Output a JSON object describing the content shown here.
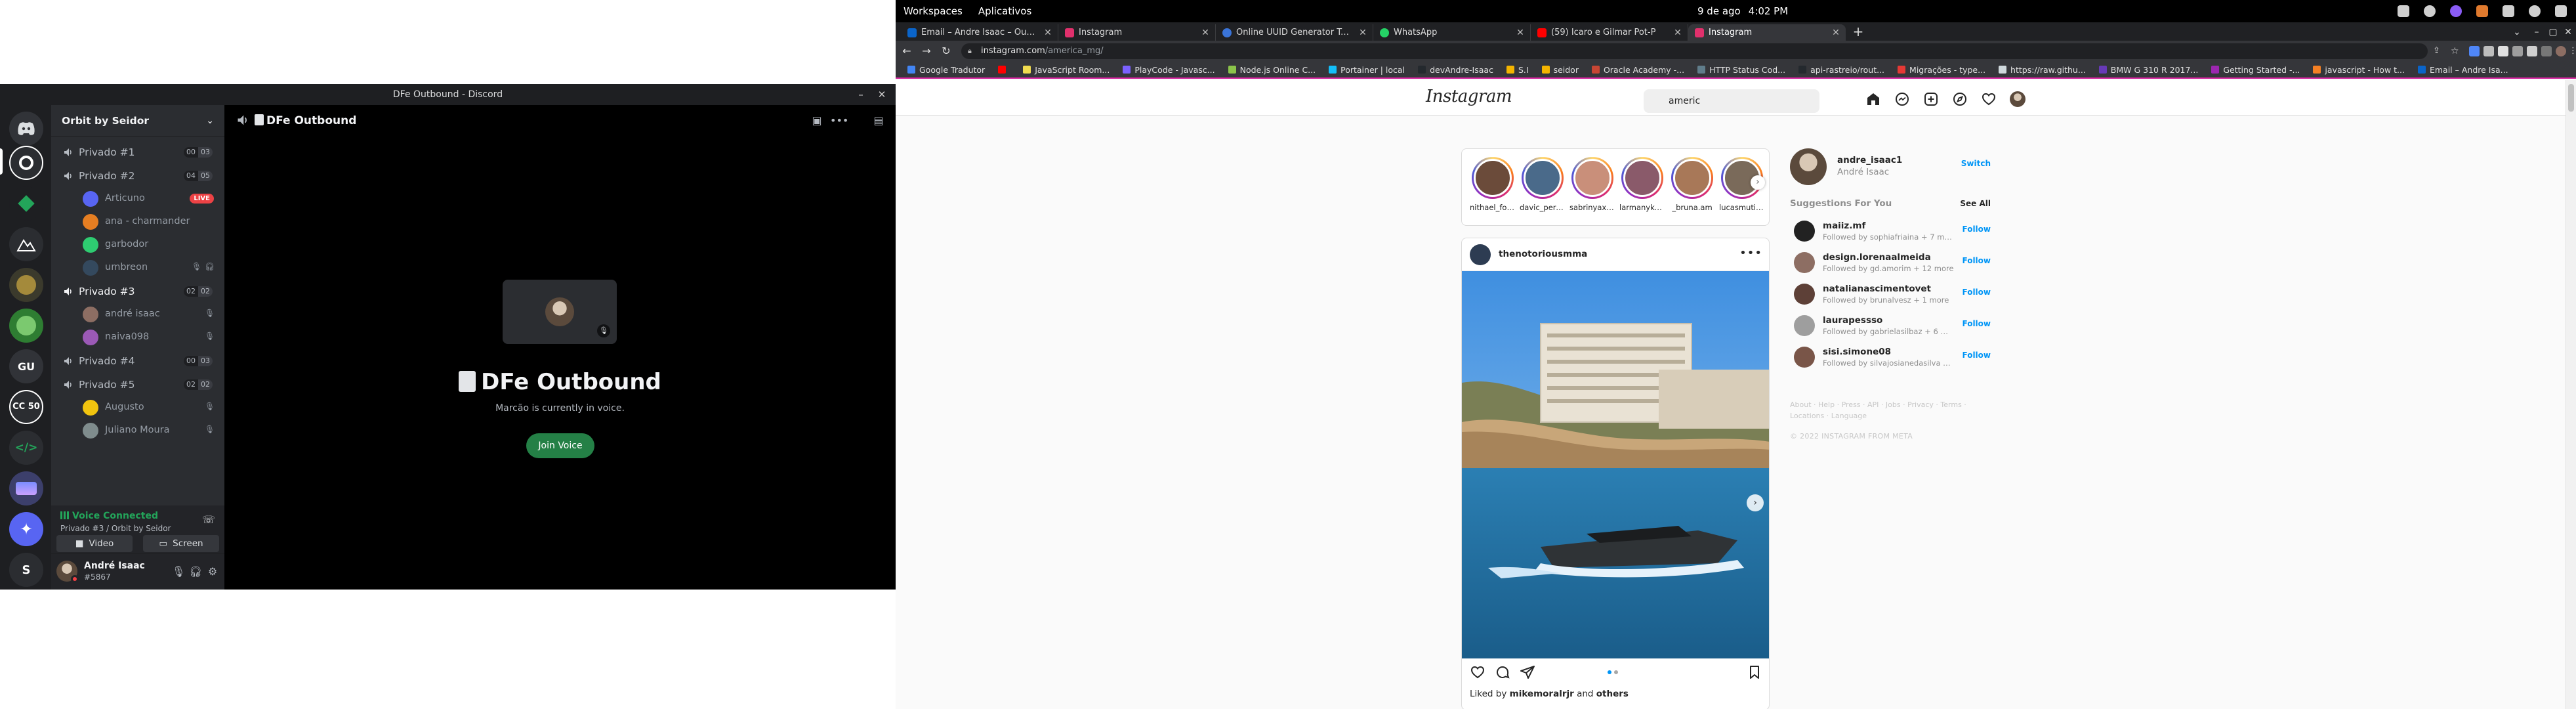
{
  "topbar": {
    "workspaces": "Workspaces",
    "apps": "Aplicativos",
    "date": "9 de ago",
    "time": "4:02 PM"
  },
  "browser": {
    "tabs": [
      {
        "title": "Email – Andre Isaac – Outlook",
        "fav": "#0a64c9"
      },
      {
        "title": "Instagram",
        "fav": "#e1306c"
      },
      {
        "title": "Online UUID Generator Tool",
        "fav": "#3a74d9"
      },
      {
        "title": "WhatsApp",
        "fav": "#25d366"
      },
      {
        "title": "(59) Icaro e Gilmar Pot-P",
        "fav": "#ff0000"
      },
      {
        "title": "Instagram",
        "fav": "#e1306c"
      }
    ],
    "url_host": "instagram.com",
    "url_path": "/america_mg/",
    "bookmarks": [
      {
        "label": "Google Tradutor",
        "fav": "#4285f4"
      },
      {
        "label": "",
        "fav": "#ff0000"
      },
      {
        "label": "JavaScript Room...",
        "fav": "#f0db4f"
      },
      {
        "label": "PlayCode - Javasc...",
        "fav": "#7b61ff"
      },
      {
        "label": "Node.js Online C...",
        "fav": "#8bc34a"
      },
      {
        "label": "Portainer | local",
        "fav": "#13bef9"
      },
      {
        "label": "devAndre-Isaac",
        "fav": "#24292e"
      },
      {
        "label": "S.I",
        "fav": "#f4b400"
      },
      {
        "label": "seidor",
        "fav": "#f4b400"
      },
      {
        "label": "Oracle Academy -...",
        "fav": "#c74634"
      },
      {
        "label": "HTTP Status Cod...",
        "fav": "#607d8b"
      },
      {
        "label": "api-rastreio/rout...",
        "fav": "#24292e"
      },
      {
        "label": "Migrações - type...",
        "fav": "#e53935"
      },
      {
        "label": "https://raw.githu...",
        "fav": "#cfd8dc"
      },
      {
        "label": "BMW G 310 R 2017...",
        "fav": "#673ab7"
      },
      {
        "label": "Getting Started -...",
        "fav": "#9c27b0"
      },
      {
        "label": "javascript - How t...",
        "fav": "#f48024"
      },
      {
        "label": "Email – Andre Isa...",
        "fav": "#0a64c9"
      }
    ]
  },
  "instagram": {
    "logo": "Instagram",
    "search_value": "americ",
    "stories": [
      {
        "name": "nithael_fon...",
        "color": "#6b4b3a"
      },
      {
        "name": "davic_perei...",
        "color": "#4a6a8a"
      },
      {
        "name": "sabrinyaxi...",
        "color": "#c98f7a"
      },
      {
        "name": "larmanykel...",
        "color": "#8a5a6a"
      },
      {
        "name": "_bruna.am",
        "color": "#a87858"
      },
      {
        "name": "lucasmutil...",
        "color": "#7a6a5a"
      }
    ],
    "post": {
      "user": "thenotoriousmma",
      "liked_by_prefix": "Liked by ",
      "liked_by_user": "mikemoralrjr",
      "liked_by_mid": " and ",
      "liked_by_others": "others"
    },
    "me": {
      "username": "andre_isaac1",
      "name": "André Isaac",
      "switch": "Switch"
    },
    "suggestions_title": "Suggestions For You",
    "see_all": "See All",
    "suggestions": [
      {
        "user": "maiiz.mf",
        "followed": "Followed by sophiafriaina + 7 more",
        "follow": "Follow",
        "color": "#222222"
      },
      {
        "user": "design.lorenaalmeida",
        "followed": "Followed by gd.amorim + 12 more",
        "follow": "Follow",
        "color": "#8d6e63"
      },
      {
        "user": "natalianascimentovet",
        "followed": "Followed by brunalvesz + 1 more",
        "follow": "Follow",
        "color": "#5d4037"
      },
      {
        "user": "laurapessso",
        "followed": "Followed by gabrielasilbaz + 6 more",
        "follow": "Follow",
        "color": "#9e9e9e"
      },
      {
        "user": "sisi.simone08",
        "followed": "Followed by silvajosianedasilva + 1...",
        "follow": "Follow",
        "color": "#795548"
      }
    ],
    "footer_line1": "About · Help · Press · API · Jobs · Privacy · Terms ·",
    "footer_line2": "Locations · Language",
    "copyright": "© 2022 INSTAGRAM FROM META"
  },
  "discord": {
    "window_title": "DFe Outbound - Discord",
    "guild": "Orbit by Seidor",
    "server_gu": "GU",
    "server_cc": "CC 50",
    "channels": [
      {
        "name": "Privado #1",
        "count_a": "00",
        "count_b": "03"
      },
      {
        "name": "Privado #2",
        "count_a": "04",
        "count_b": "05"
      },
      {
        "name": "Privado #3",
        "count_a": "02",
        "count_b": "02"
      },
      {
        "name": "Privado #4",
        "count_a": "00",
        "count_b": "03"
      },
      {
        "name": "Privado #5",
        "count_a": "02",
        "count_b": "02"
      }
    ],
    "users_p2": [
      {
        "name": "Articuno",
        "color": "#5865f2",
        "live": "LIVE"
      },
      {
        "name": "ana - charmander",
        "color": "#e67e22"
      },
      {
        "name": "garbodor",
        "color": "#2ecc71"
      },
      {
        "name": "umbreon",
        "color": "#34495e"
      }
    ],
    "users_p3": [
      {
        "name": "andré isaac",
        "color": "#8d6e63"
      },
      {
        "name": "naiva098",
        "color": "#9b59b6"
      }
    ],
    "users_p5": [
      {
        "name": "Augusto",
        "color": "#f1c40f"
      },
      {
        "name": "Juliano Moura",
        "color": "#7f8c8d"
      }
    ],
    "voice": {
      "status": "Voice Connected",
      "location": "Privado #3 / Orbit by Seidor",
      "video": "Video",
      "screen": "Screen"
    },
    "user": {
      "name": "André Isaac",
      "tag": "#5867"
    },
    "main": {
      "channel": "DFe Outbound",
      "title": "DFe Outbound",
      "subtitle": "Marcão is currently in voice.",
      "join": "Join Voice"
    }
  }
}
